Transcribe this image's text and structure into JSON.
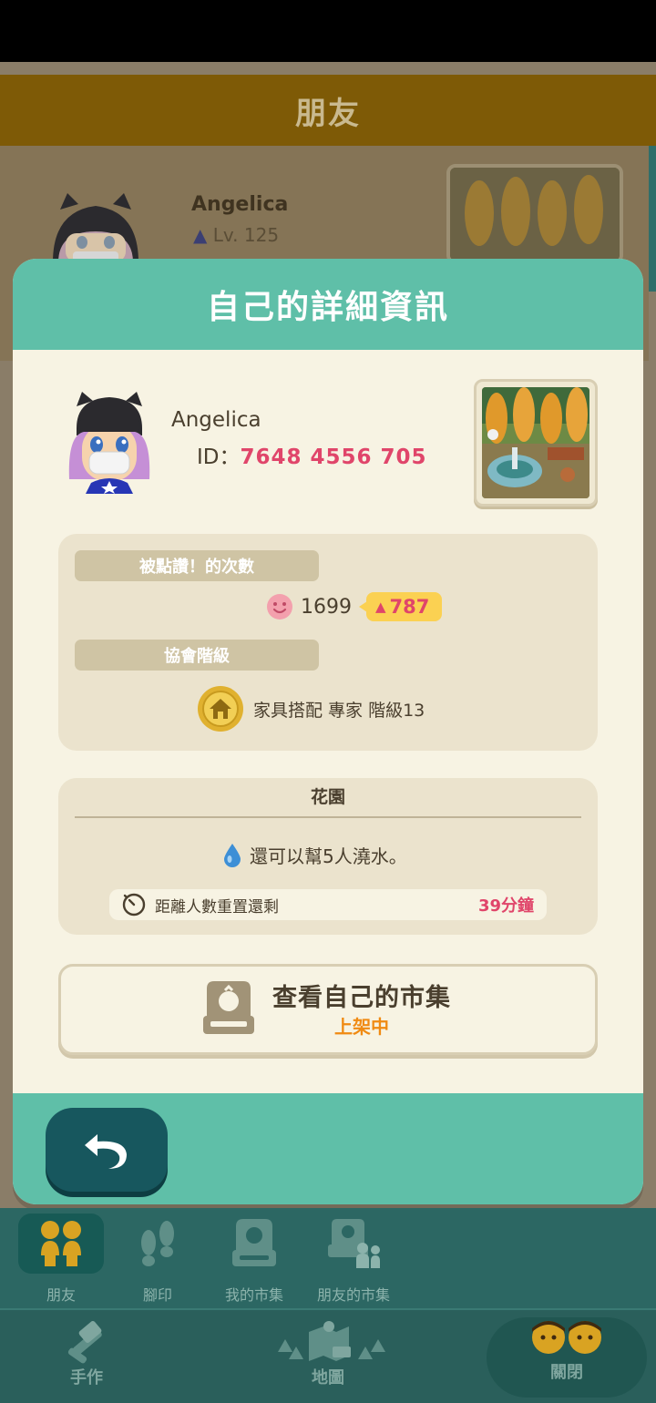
{
  "background": {
    "header_title": "朋友",
    "friend_name": "Angelica",
    "friend_level": "Lv. 125"
  },
  "modal": {
    "title": "自己的詳細資訊",
    "profile": {
      "name": "Angelica",
      "id_label": "ID：",
      "id_value": "7648 4556 705"
    },
    "likes": {
      "label": "被點讚！的次數",
      "count": "1699",
      "delta": "787"
    },
    "association": {
      "label": "協會階級",
      "rank_text": "家具搭配 專家 階級13"
    },
    "garden": {
      "title": "花園",
      "watering_text": "還可以幫5人澆水。",
      "reset_label": "距離人數重置還剩",
      "reset_time": "39分鐘"
    },
    "market_button": {
      "title": "查看自己的市集",
      "status": "上架中"
    }
  },
  "nav": {
    "tabs": [
      {
        "label": "朋友",
        "icon": "friends-icon",
        "active": true
      },
      {
        "label": "腳印",
        "icon": "footprints-icon",
        "active": false
      },
      {
        "label": "我的市集",
        "icon": "my-market-icon",
        "active": false
      },
      {
        "label": "朋友的市集",
        "icon": "friends-market-icon",
        "active": false
      }
    ],
    "craft_label": "手作",
    "map_label": "地圖",
    "close_label": "關閉"
  },
  "colors": {
    "accent": "#5fbfa8",
    "highlight_text": "#e0456a",
    "status_orange": "#f08a12"
  }
}
